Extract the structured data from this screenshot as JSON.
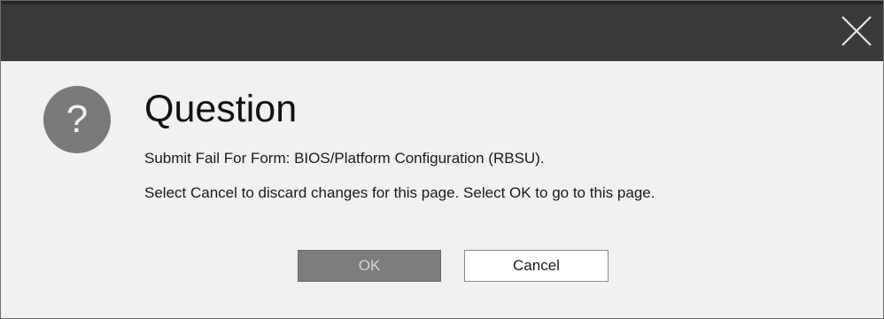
{
  "dialog": {
    "title": "Question",
    "icon": "question-mark-icon",
    "icon_glyph": "?",
    "close_icon": "close-icon",
    "message_lines": [
      "Submit Fail For Form: BIOS/Platform Configuration (RBSU).",
      "Select Cancel to discard changes for this page. Select OK to go to this page."
    ],
    "buttons": {
      "ok_label": "OK",
      "cancel_label": "Cancel"
    }
  },
  "colors": {
    "titlebar": "#3a3a3a",
    "body": "#f1f1f1",
    "icon": "#7a7a7a",
    "ok_button": "#7d7d7d"
  }
}
